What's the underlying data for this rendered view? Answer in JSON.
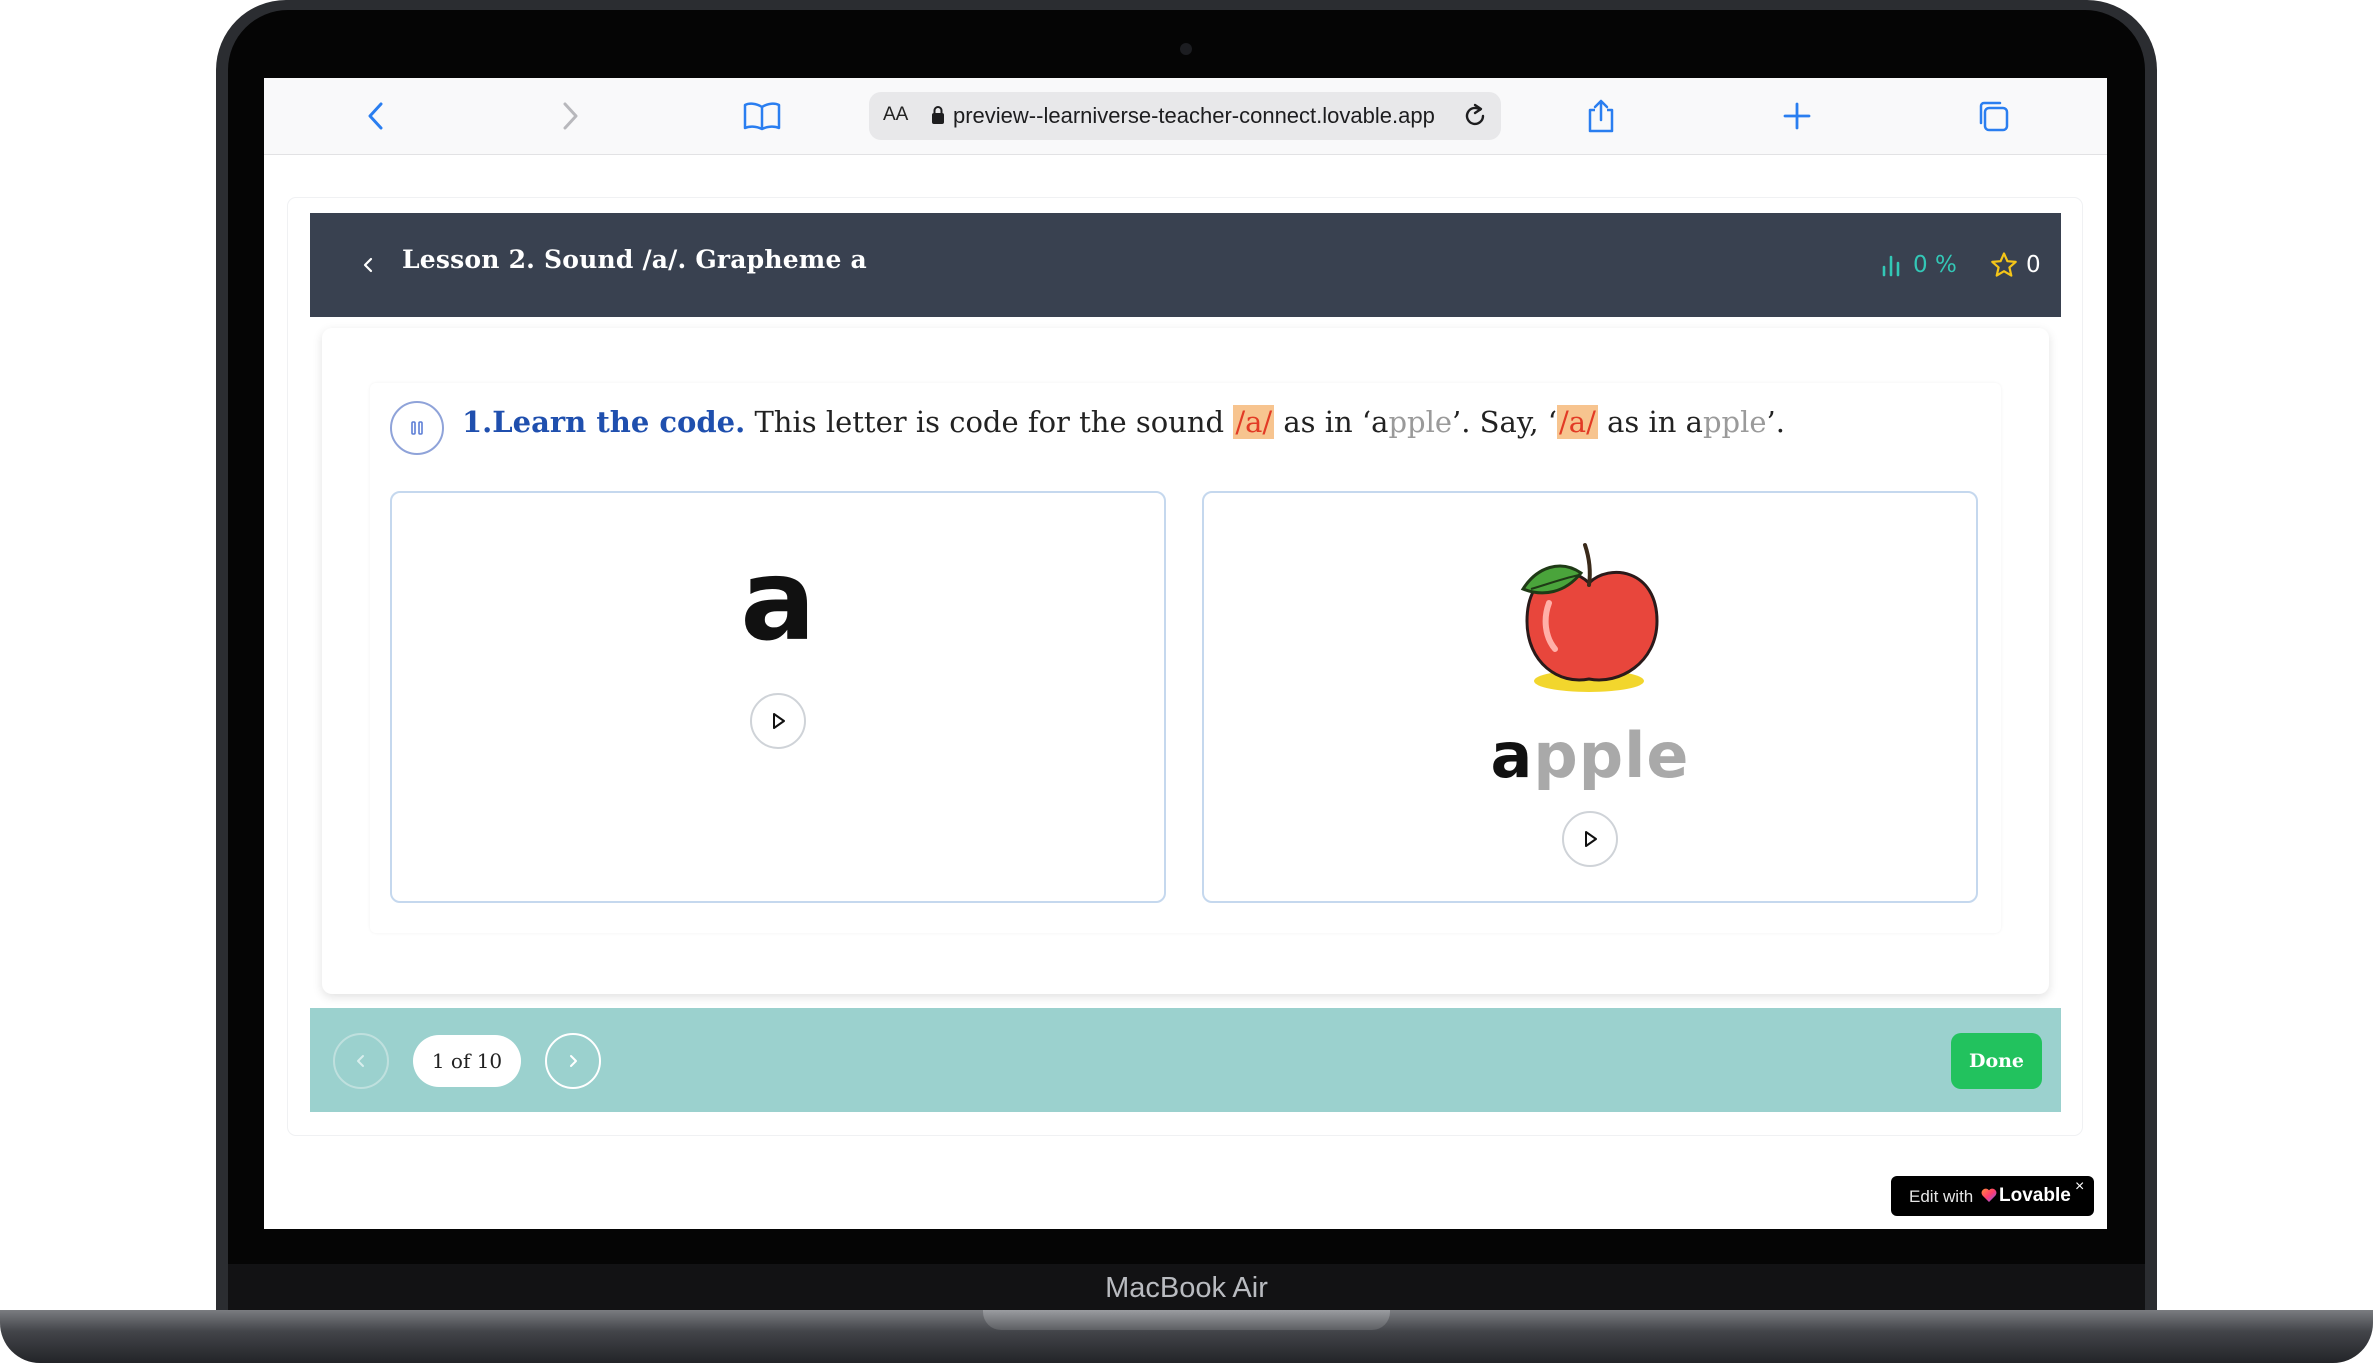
{
  "device": {
    "brand_label": "MacBook Air"
  },
  "browser": {
    "text_size_label": "AA",
    "url": "preview--learniverse-teacher-connect.lovable.app",
    "icons": [
      "back-icon",
      "forward-icon",
      "bookmarks-icon",
      "lock-icon",
      "reload-icon",
      "share-icon",
      "new-tab-icon",
      "tabs-icon"
    ]
  },
  "lesson": {
    "title": "Lesson 2. Sound /a/. Grapheme a",
    "progress": "0 %",
    "progress_value": 0,
    "stars": "0"
  },
  "activity": {
    "step_title": "1.Learn the code.",
    "text_1": "This letter is code for the sound",
    "sound_1": "/a/",
    "text_2": "as in ‘",
    "word_1_first": "a",
    "word_1_rest": "pple",
    "text_3": "’. Say, ‘",
    "sound_2": "/a/",
    "text_4": "as in",
    "word_2_first": "a",
    "word_2_rest": "pple",
    "text_5": "’."
  },
  "cards": {
    "letter": "a",
    "word_first": "a",
    "word_rest": "pple",
    "image": "apple-illustration"
  },
  "footer": {
    "pagination": "1 of 10",
    "done_label": "Done"
  },
  "badge": {
    "edit_with": "Edit with",
    "brand": "Lovable",
    "close": "×"
  },
  "colors": {
    "header_bg": "#394150",
    "footer_bg": "#9bd1ce",
    "accent_teal": "#33c7b6",
    "done_green": "#22c25e",
    "highlight_bg": "#f7c48f",
    "highlight_text": "#e23a25",
    "step_title_blue": "#1f4fae"
  }
}
